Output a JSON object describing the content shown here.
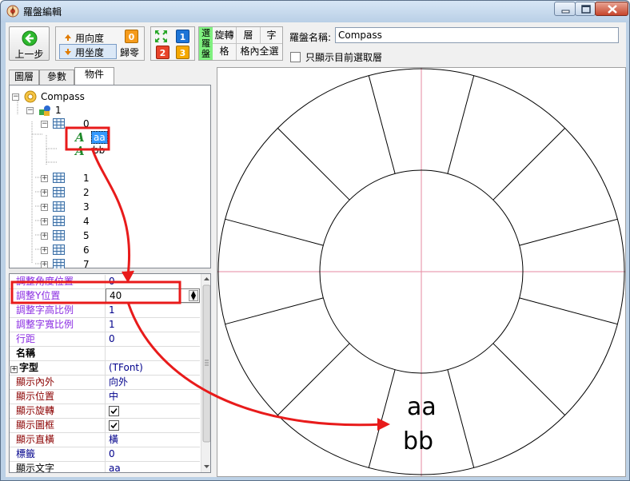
{
  "window": {
    "title": "羅盤編輯"
  },
  "toolbar": {
    "back_label": "上一步",
    "use_angle_label": "用向度",
    "use_coord_label": "用坐度",
    "reset_badge": "0",
    "reset_label": "歸零",
    "btn_1": "1",
    "btn_2": "2",
    "btn_3": "3",
    "mode_badge": "選羅盤",
    "rotate_label": "旋轉",
    "layer_label": "層",
    "char_label": "字",
    "cell_label": "格",
    "select_all_label": "格內全選",
    "name_label": "羅盤名稱:",
    "name_value": "Compass",
    "only_selected_label": "只顯示目前選取層"
  },
  "tabs": [
    "圖層",
    "參數",
    "物件"
  ],
  "tree": {
    "root": "Compass",
    "layer": "1",
    "group0": "0",
    "item_aa": "aa",
    "item_bb": "bb",
    "groups": [
      "1",
      "2",
      "3",
      "4",
      "5",
      "6",
      "7"
    ]
  },
  "properties": [
    {
      "key": "調整角度位置",
      "value": "0",
      "key_color": "#8a2be2"
    },
    {
      "key": "調整Y位置",
      "value": "40",
      "key_color": "#8a2be2"
    },
    {
      "key": "調整字高比例",
      "value": "1",
      "key_color": "#8a2be2"
    },
    {
      "key": "調整字寬比例",
      "value": "1",
      "key_color": "#8a2be2"
    },
    {
      "key": "行距",
      "value": "0",
      "key_color": "#8a2be2"
    },
    {
      "key": "名稱",
      "value": "",
      "key_color": "#000000"
    },
    {
      "key": "字型",
      "value": "(TFont)",
      "key_color": "#000000"
    },
    {
      "key": "顯示內外",
      "value": "向外",
      "key_color": "#8b0000"
    },
    {
      "key": "顯示位置",
      "value": "中",
      "key_color": "#8b0000"
    },
    {
      "key": "顯示旋轉",
      "value": "",
      "key_color": "#8b0000"
    },
    {
      "key": "顯示圖框",
      "value": "",
      "key_color": "#8b0000"
    },
    {
      "key": "顯示直橫",
      "value": "橫",
      "key_color": "#8b0000"
    },
    {
      "key": "標籤",
      "value": "0",
      "key_color": "#00008b"
    },
    {
      "key": "顯示文字",
      "value": "aa",
      "key_color": "#000000"
    }
  ],
  "canvas": {
    "line1": "aa",
    "line2": "bb"
  },
  "colors": {
    "highlight": "#e81b1b",
    "crosshair": "#e58aa2",
    "selection": "#3399ff"
  }
}
